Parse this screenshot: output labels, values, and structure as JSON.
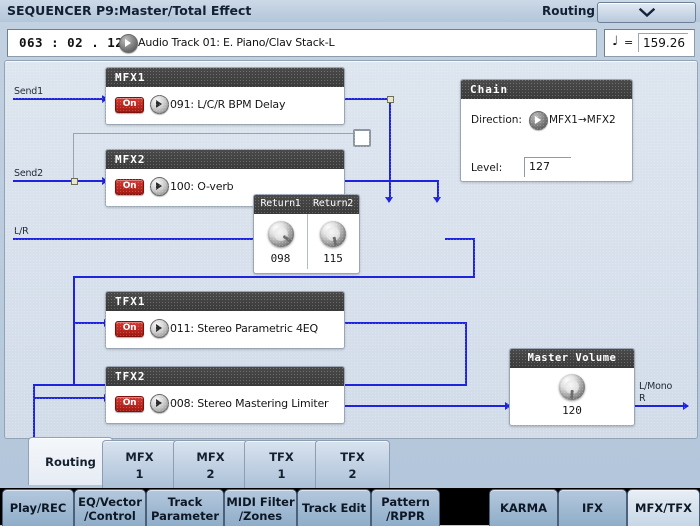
{
  "header": {
    "title": "SEQUENCER P9:Master/Total Effect",
    "routing_label": "Routing",
    "page_select_icon": "chevron-down-icon"
  },
  "location_bar": {
    "measure": "063 : 02 . 125",
    "track_arrow_icon": "arrow-right-circle-icon",
    "track": "Audio Track 01: E. Piano/Clav Stack-L",
    "tempo_note_glyph": "♩",
    "tempo_equals": "=",
    "tempo_value": "159.26"
  },
  "signal_labels": {
    "send1": "Send1",
    "send2": "Send2",
    "lr": "L/R",
    "output": "L/Mono",
    "output2": "R"
  },
  "effects": [
    {
      "id": "mfx1",
      "title": "MFX1",
      "on_label": "On",
      "program": "091: L/C/R BPM Delay",
      "arrow_icon": "arrow-right-circle-icon"
    },
    {
      "id": "mfx2",
      "title": "MFX2",
      "on_label": "On",
      "program": "100: O-verb",
      "arrow_icon": "arrow-right-circle-icon"
    },
    {
      "id": "tfx1",
      "title": "TFX1",
      "on_label": "On",
      "program": "011: Stereo Parametric 4EQ",
      "arrow_icon": "arrow-right-circle-icon"
    },
    {
      "id": "tfx2",
      "title": "TFX2",
      "on_label": "On",
      "program": "008: Stereo Mastering Limiter",
      "arrow_icon": "arrow-right-circle-icon"
    }
  ],
  "chain": {
    "title": "Chain",
    "direction_label": "Direction:",
    "direction_value": "MFX1→MFX2",
    "direction_arrow_icon": "arrow-right-circle-icon",
    "level_label": "Level:",
    "level_value": "127"
  },
  "returns": {
    "return1_label": "Return1",
    "return1_value": "098",
    "return1_angle": 128,
    "return2_label": "Return2",
    "return2_value": "115",
    "return2_angle": 168
  },
  "master_volume": {
    "title": "Master Volume",
    "value": "120",
    "angle": 185
  },
  "page_tabs": [
    {
      "name": "routing",
      "line1": "Routing",
      "line2": "",
      "active": true
    },
    {
      "name": "mfx1",
      "line1": "MFX",
      "line2": "1",
      "active": false
    },
    {
      "name": "mfx2",
      "line1": "MFX",
      "line2": "2",
      "active": false
    },
    {
      "name": "tfx1",
      "line1": "TFX",
      "line2": "1",
      "active": false
    },
    {
      "name": "tfx2",
      "line1": "TFX",
      "line2": "2",
      "active": false
    }
  ],
  "bottom_tabs": [
    {
      "name": "play-rec",
      "line1": "Play/REC",
      "line2": "",
      "active": false
    },
    {
      "name": "eq-vector",
      "line1": "EQ/Vector",
      "line2": "/Control",
      "active": false
    },
    {
      "name": "track-parameter",
      "line1": "Track",
      "line2": "Parameter",
      "active": false
    },
    {
      "name": "midi-filter",
      "line1": "MIDI Filter",
      "line2": "/Zones",
      "active": false
    },
    {
      "name": "track-edit",
      "line1": "Track Edit",
      "line2": "",
      "active": false
    },
    {
      "name": "pattern-rppr",
      "line1": "Pattern",
      "line2": "/RPPR",
      "active": false
    },
    {
      "name": "karma",
      "line1": "KARMA",
      "line2": "",
      "active": false
    },
    {
      "name": "ifx",
      "line1": "IFX",
      "line2": "",
      "active": false
    },
    {
      "name": "mfx-tfx",
      "line1": "MFX/TFX",
      "line2": "",
      "active": true
    }
  ],
  "colors": {
    "wire": "#1e23e0",
    "on_button": "#b51c13",
    "header_dark": "#3f3f3f",
    "panel_bg": "#d7e0ec"
  }
}
